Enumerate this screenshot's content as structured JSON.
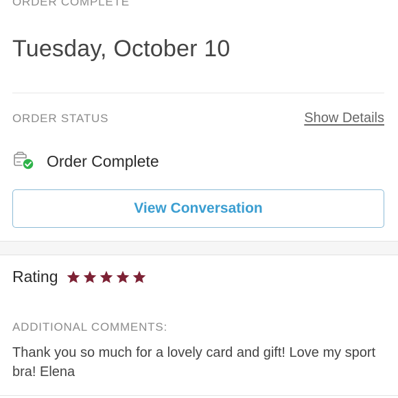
{
  "header": {
    "eyebrow": "ORDER COMPLETE",
    "date": "Tuesday, October 10"
  },
  "order_status": {
    "label": "ORDER STATUS",
    "show_details": "Show Details",
    "status": "Order Complete",
    "status_icon": "package-check-icon",
    "status_color": "#2fb34a"
  },
  "actions": {
    "view_conversation": "View Conversation",
    "accent": "#3b9ed1"
  },
  "rating": {
    "label": "Rating",
    "stars": 5,
    "max": 5,
    "star_color": "#7d2235"
  },
  "comments": {
    "label": "ADDITIONAL COMMENTS:",
    "text": "Thank you so much for a lovely card and gift! Love my sport bra! Elena"
  }
}
